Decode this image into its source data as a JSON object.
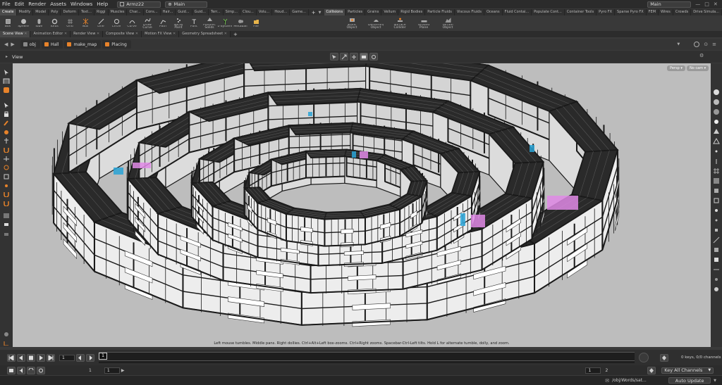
{
  "menu": {
    "items": [
      "File",
      "Edit",
      "Render",
      "Assets",
      "Windows",
      "Help"
    ],
    "desktop": "Armz22",
    "context": "Main",
    "right_context": "Main"
  },
  "shelf_left": {
    "tabs": [
      "Create",
      "Modify",
      "Model",
      "Poly",
      "Deform",
      "Text...",
      "Riggi",
      "Muscles",
      "Char...",
      "Cons...",
      "Hair...",
      "Guid...",
      "Guid...",
      "Terr...",
      "Simp...",
      "Clou...",
      "Volu...",
      "Houd...",
      "Game..."
    ],
    "tools": [
      "Box",
      "Sphere",
      "Tube",
      "Torus",
      "Grid",
      "Null",
      "Line",
      "Circle",
      "Curve",
      "Draw Curve",
      "Path",
      "Spray Paint",
      "Font",
      "Platonic Solids",
      "L-System",
      "Metaball",
      "File"
    ]
  },
  "shelf_right": {
    "tabs": [
      "Collisions",
      "Particles",
      "Grains",
      "Vellum",
      "Rigid Bodies",
      "Particle Fluids",
      "Viscous Fluids",
      "Oceans",
      "Fluid Contai...",
      "Populate Cont...",
      "Container Tools",
      "Pyro FX",
      "Sparse Pyro FX",
      "FEM",
      "Wires",
      "Crowds",
      "Drive Simula..."
    ],
    "tools": [
      "Static Object",
      "Deforming Object",
      "Surface Collider",
      "Ground Plane",
      "Terrain Object"
    ]
  },
  "pane_tabs": [
    "Scene View",
    "Animation Editor",
    "Render View",
    "Composite View",
    "Motion FX View",
    "Geometry Spreadsheet"
  ],
  "path": [
    "obj",
    "Hall",
    "make_map",
    "Placing"
  ],
  "view_title": "View",
  "viewport": {
    "persp": "Persp",
    "cam": "No cam",
    "hint": "Left mouse tumbles. Middle pans. Right dollies. Ctrl+Alt+Left box-zooms. Ctrl+Right zooms. Spacebar-Ctrl-Left tilts. Hold L for alternate tumble, dolly, and zoom."
  },
  "playbar": {
    "frame": "1",
    "marker": "1",
    "range_start": "1",
    "range_start2": "1",
    "range_end": "1",
    "range_end2": "2",
    "keys": "0 keys, 0/0 channels",
    "key_channels": "Key All Channels"
  },
  "status": {
    "path": "/obj/Words/sat...",
    "update": "Auto Update"
  },
  "colors": {
    "accent": "#e8832a",
    "viewport_bg": "#bdbdbd",
    "wire": "#1a1a1a",
    "highlight_pink": "#e08ae6",
    "highlight_cyan": "#29a3d6"
  }
}
